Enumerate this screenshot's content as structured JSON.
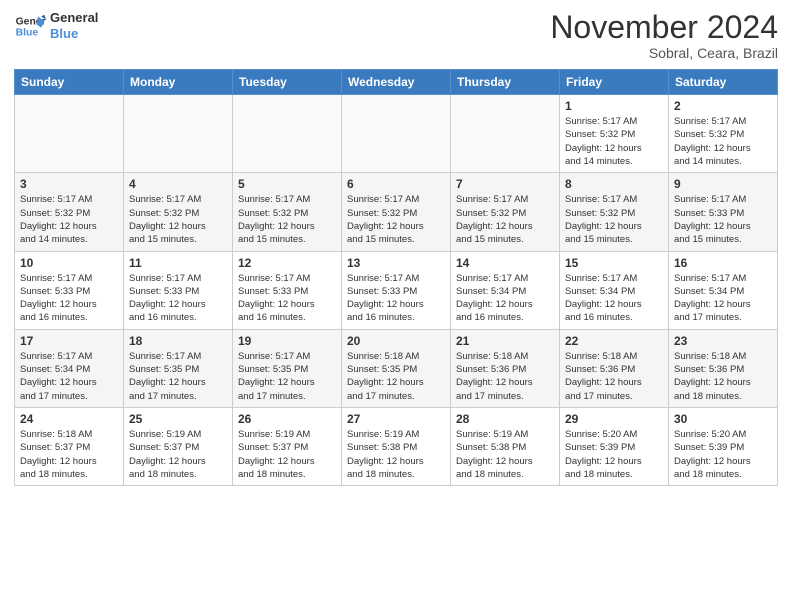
{
  "header": {
    "logo_line1": "General",
    "logo_line2": "Blue",
    "month_title": "November 2024",
    "subtitle": "Sobral, Ceara, Brazil"
  },
  "weekdays": [
    "Sunday",
    "Monday",
    "Tuesday",
    "Wednesday",
    "Thursday",
    "Friday",
    "Saturday"
  ],
  "weeks": [
    [
      {
        "day": "",
        "info": ""
      },
      {
        "day": "",
        "info": ""
      },
      {
        "day": "",
        "info": ""
      },
      {
        "day": "",
        "info": ""
      },
      {
        "day": "",
        "info": ""
      },
      {
        "day": "1",
        "info": "Sunrise: 5:17 AM\nSunset: 5:32 PM\nDaylight: 12 hours\nand 14 minutes."
      },
      {
        "day": "2",
        "info": "Sunrise: 5:17 AM\nSunset: 5:32 PM\nDaylight: 12 hours\nand 14 minutes."
      }
    ],
    [
      {
        "day": "3",
        "info": "Sunrise: 5:17 AM\nSunset: 5:32 PM\nDaylight: 12 hours\nand 14 minutes."
      },
      {
        "day": "4",
        "info": "Sunrise: 5:17 AM\nSunset: 5:32 PM\nDaylight: 12 hours\nand 15 minutes."
      },
      {
        "day": "5",
        "info": "Sunrise: 5:17 AM\nSunset: 5:32 PM\nDaylight: 12 hours\nand 15 minutes."
      },
      {
        "day": "6",
        "info": "Sunrise: 5:17 AM\nSunset: 5:32 PM\nDaylight: 12 hours\nand 15 minutes."
      },
      {
        "day": "7",
        "info": "Sunrise: 5:17 AM\nSunset: 5:32 PM\nDaylight: 12 hours\nand 15 minutes."
      },
      {
        "day": "8",
        "info": "Sunrise: 5:17 AM\nSunset: 5:32 PM\nDaylight: 12 hours\nand 15 minutes."
      },
      {
        "day": "9",
        "info": "Sunrise: 5:17 AM\nSunset: 5:33 PM\nDaylight: 12 hours\nand 15 minutes."
      }
    ],
    [
      {
        "day": "10",
        "info": "Sunrise: 5:17 AM\nSunset: 5:33 PM\nDaylight: 12 hours\nand 16 minutes."
      },
      {
        "day": "11",
        "info": "Sunrise: 5:17 AM\nSunset: 5:33 PM\nDaylight: 12 hours\nand 16 minutes."
      },
      {
        "day": "12",
        "info": "Sunrise: 5:17 AM\nSunset: 5:33 PM\nDaylight: 12 hours\nand 16 minutes."
      },
      {
        "day": "13",
        "info": "Sunrise: 5:17 AM\nSunset: 5:33 PM\nDaylight: 12 hours\nand 16 minutes."
      },
      {
        "day": "14",
        "info": "Sunrise: 5:17 AM\nSunset: 5:34 PM\nDaylight: 12 hours\nand 16 minutes."
      },
      {
        "day": "15",
        "info": "Sunrise: 5:17 AM\nSunset: 5:34 PM\nDaylight: 12 hours\nand 16 minutes."
      },
      {
        "day": "16",
        "info": "Sunrise: 5:17 AM\nSunset: 5:34 PM\nDaylight: 12 hours\nand 17 minutes."
      }
    ],
    [
      {
        "day": "17",
        "info": "Sunrise: 5:17 AM\nSunset: 5:34 PM\nDaylight: 12 hours\nand 17 minutes."
      },
      {
        "day": "18",
        "info": "Sunrise: 5:17 AM\nSunset: 5:35 PM\nDaylight: 12 hours\nand 17 minutes."
      },
      {
        "day": "19",
        "info": "Sunrise: 5:17 AM\nSunset: 5:35 PM\nDaylight: 12 hours\nand 17 minutes."
      },
      {
        "day": "20",
        "info": "Sunrise: 5:18 AM\nSunset: 5:35 PM\nDaylight: 12 hours\nand 17 minutes."
      },
      {
        "day": "21",
        "info": "Sunrise: 5:18 AM\nSunset: 5:36 PM\nDaylight: 12 hours\nand 17 minutes."
      },
      {
        "day": "22",
        "info": "Sunrise: 5:18 AM\nSunset: 5:36 PM\nDaylight: 12 hours\nand 17 minutes."
      },
      {
        "day": "23",
        "info": "Sunrise: 5:18 AM\nSunset: 5:36 PM\nDaylight: 12 hours\nand 18 minutes."
      }
    ],
    [
      {
        "day": "24",
        "info": "Sunrise: 5:18 AM\nSunset: 5:37 PM\nDaylight: 12 hours\nand 18 minutes."
      },
      {
        "day": "25",
        "info": "Sunrise: 5:19 AM\nSunset: 5:37 PM\nDaylight: 12 hours\nand 18 minutes."
      },
      {
        "day": "26",
        "info": "Sunrise: 5:19 AM\nSunset: 5:37 PM\nDaylight: 12 hours\nand 18 minutes."
      },
      {
        "day": "27",
        "info": "Sunrise: 5:19 AM\nSunset: 5:38 PM\nDaylight: 12 hours\nand 18 minutes."
      },
      {
        "day": "28",
        "info": "Sunrise: 5:19 AM\nSunset: 5:38 PM\nDaylight: 12 hours\nand 18 minutes."
      },
      {
        "day": "29",
        "info": "Sunrise: 5:20 AM\nSunset: 5:39 PM\nDaylight: 12 hours\nand 18 minutes."
      },
      {
        "day": "30",
        "info": "Sunrise: 5:20 AM\nSunset: 5:39 PM\nDaylight: 12 hours\nand 18 minutes."
      }
    ]
  ]
}
